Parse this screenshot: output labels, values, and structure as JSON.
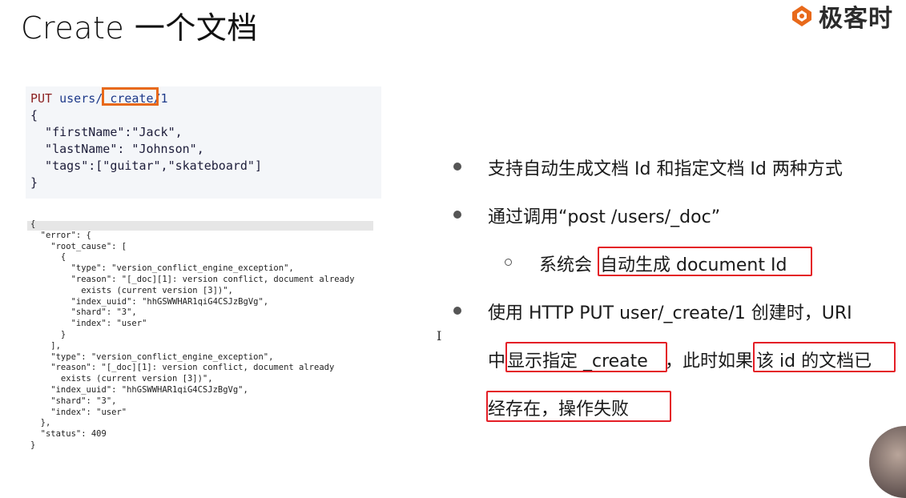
{
  "slide": {
    "title": "Create 一个文档"
  },
  "logo": {
    "text": "极客时",
    "icon": "geek-time-logo-icon",
    "color": "#e8691a"
  },
  "request": {
    "method": "PUT",
    "path_prefix": "users/",
    "path_create": "_create",
    "path_suffix": "/1",
    "lines": [
      "{",
      "  \"firstName\":\"Jack\",",
      "  \"lastName\": \"Johnson\",",
      "  \"tags\":[\"guitar\",\"skateboard\"]",
      "}"
    ],
    "highlight_color": "#e8691a"
  },
  "response": {
    "lines": [
      "{",
      "  \"error\": {",
      "    \"root_cause\": [",
      "      {",
      "        \"type\": \"version_conflict_engine_exception\",",
      "        \"reason\": \"[_doc][1]: version conflict, document already",
      "          exists (current version [3])\",",
      "        \"index_uuid\": \"hhGSWWHAR1qiG4CSJzBgVg\",",
      "        \"shard\": \"3\",",
      "        \"index\": \"user\"",
      "      }",
      "    ],",
      "    \"type\": \"version_conflict_engine_exception\",",
      "    \"reason\": \"[_doc][1]: version conflict, document already",
      "      exists (current version [3])\",",
      "    \"index_uuid\": \"hhGSWWHAR1qiG4CSJzBgVg\",",
      "    \"shard\": \"3\",",
      "    \"index\": \"user\"",
      "  },",
      "  \"status\": 409",
      "}"
    ]
  },
  "bullets": {
    "b1": "支持自动生成文档 Id 和指定文档 Id 两种方式",
    "b2": "通过调用“post /users/_doc”",
    "b2_sub_prefix": "系统会",
    "b2_sub_hl": "自动生成 document Id",
    "b3_line1": "使用 HTTP PUT  user/_create/1 创建时，URI",
    "b3_line2_a": "中",
    "b3_line2_hl1": "显示指定 _create",
    "b3_line2_b": "，此时如果",
    "b3_line2_hl2": "该 id 的文档已",
    "b3_line3_hl": "经存在，操作失败"
  },
  "colors": {
    "red_box": "#e41e26",
    "create_box": "#e8691a"
  }
}
